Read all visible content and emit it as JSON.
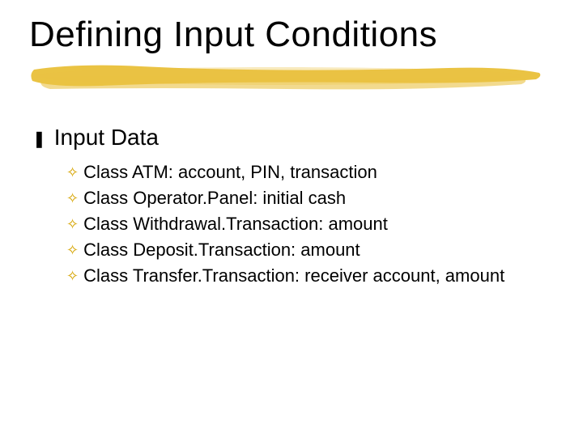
{
  "title": "Defining Input Conditions",
  "section": {
    "heading": "Input Data",
    "items": [
      "Class ATM: account, PIN, transaction",
      "Class Operator.Panel: initial cash",
      "Class Withdrawal.Transaction: amount",
      "Class Deposit.Transaction: amount",
      "Class Transfer.Transaction: receiver account, amount"
    ]
  },
  "bullets": {
    "level1": "❚",
    "level2": "✧"
  }
}
